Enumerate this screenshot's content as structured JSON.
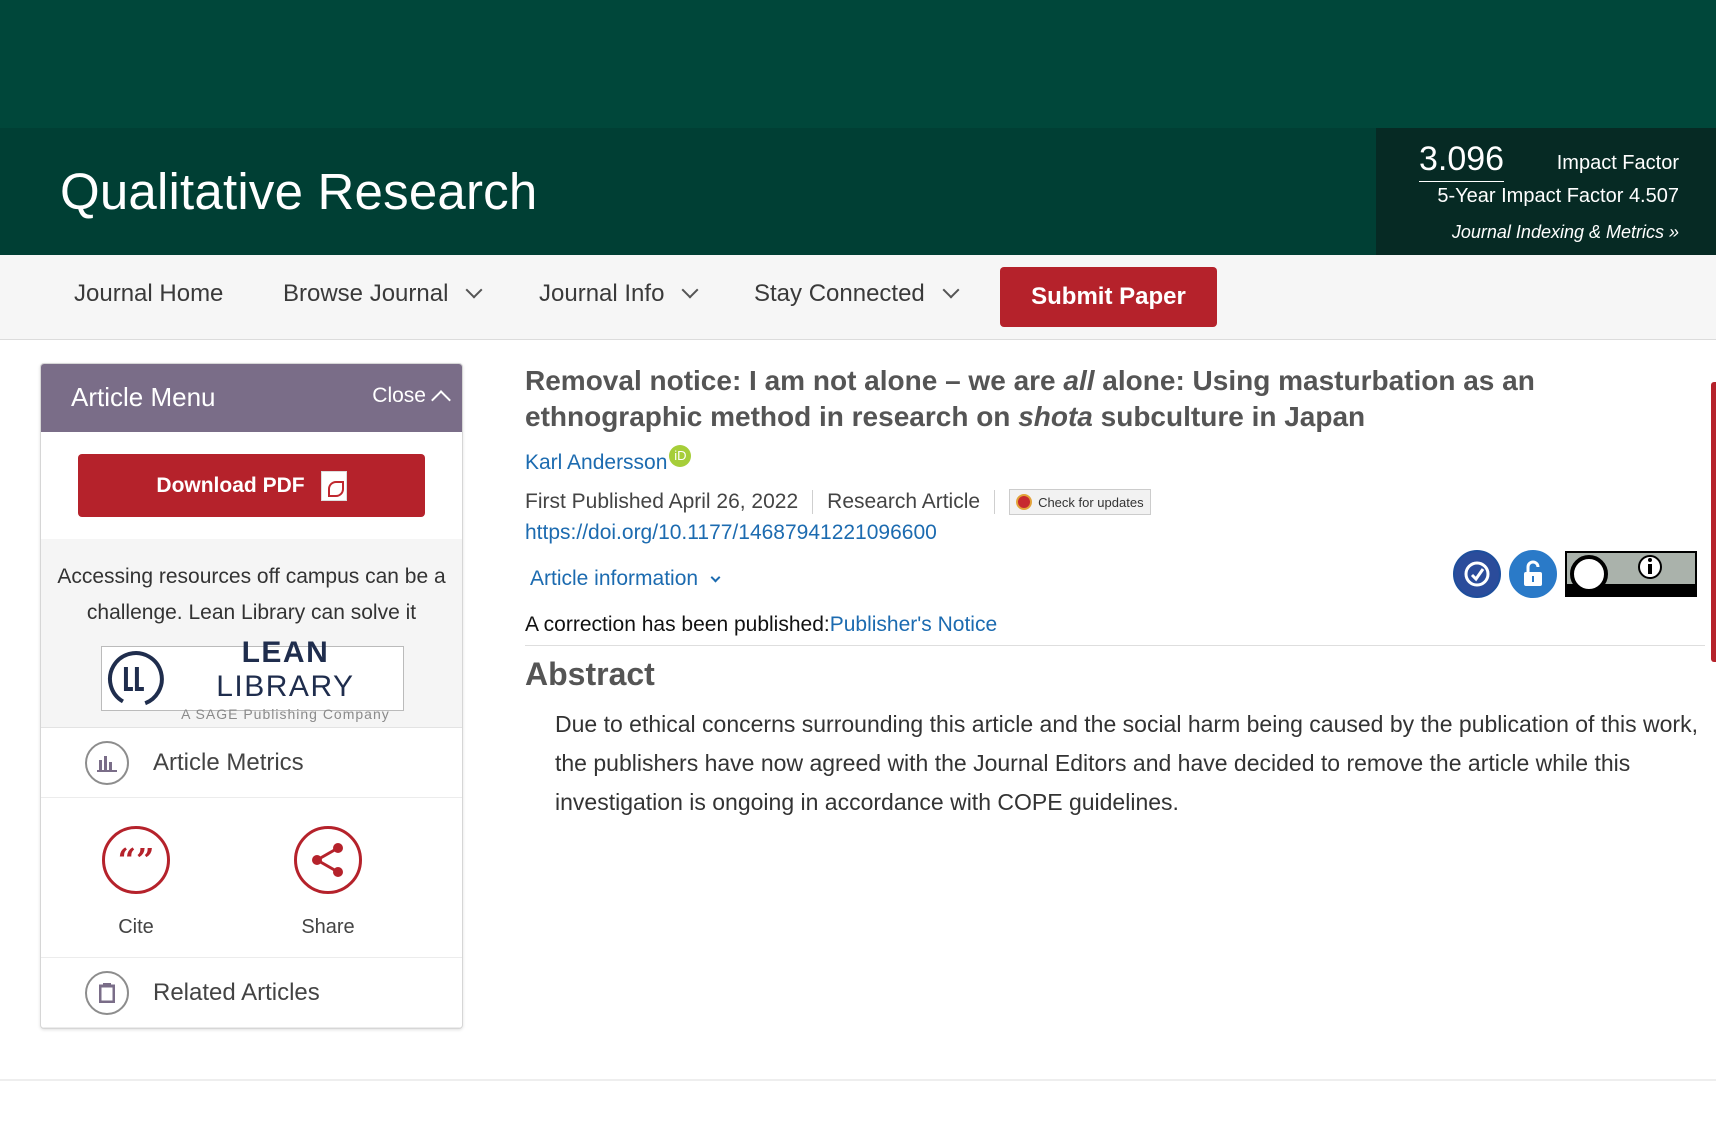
{
  "header": {
    "journal_title": "Qualitative Research",
    "impact_factor_value": "3.096",
    "impact_factor_label": "Impact Factor",
    "five_year": "5-Year Impact Factor 4.507",
    "indexing_link": "Journal Indexing & Metrics »"
  },
  "nav": {
    "items": [
      "Journal Home",
      "Browse Journal",
      "Journal Info",
      "Stay Connected"
    ],
    "submit_label": "Submit Paper"
  },
  "sidebar": {
    "title": "Article Menu",
    "close_label": "Close",
    "download_pdf": "Download PDF",
    "lean_text": "Accessing resources off campus can be a challenge. Lean Library can solve it",
    "lean_logo_main": "LEAN",
    "lean_logo_second": "LIBRARY",
    "lean_logo_sub": "A SAGE Publishing Company",
    "metrics_label": "Article Metrics",
    "cite_label": "Cite",
    "share_label": "Share",
    "related_label": "Related Articles"
  },
  "article": {
    "title_part1": "Removal notice: I am not alone – we are ",
    "title_em1": "all",
    "title_part2": " alone: Using masturbation as an ethnographic method in research on ",
    "title_em2": "shota",
    "title_part3": " subculture in Japan",
    "author": "Karl Andersson",
    "orcid_badge": "iD",
    "first_published": "First Published April 26, 2022",
    "article_type": "Research Article",
    "check_updates": "Check for updates",
    "doi": "https://doi.org/10.1177/14687941221096600",
    "article_info": "Article information",
    "correction_prefix": "A correction has been published:",
    "correction_link": "Publisher's Notice",
    "abstract_heading": "Abstract",
    "abstract_text": "Due to ethical concerns surrounding this article and the social harm being caused by the publication of this work, the publishers have now agreed with the Journal Editors and have decided to remove the article while this investigation is ongoing in accordance with COPE guidelines."
  },
  "colors": {
    "header_dark": "#003f34",
    "header_top": "#00473a",
    "accent_red": "#b5222b",
    "link_blue": "#1c6bb0",
    "sidebar_header": "#7a6d88"
  }
}
